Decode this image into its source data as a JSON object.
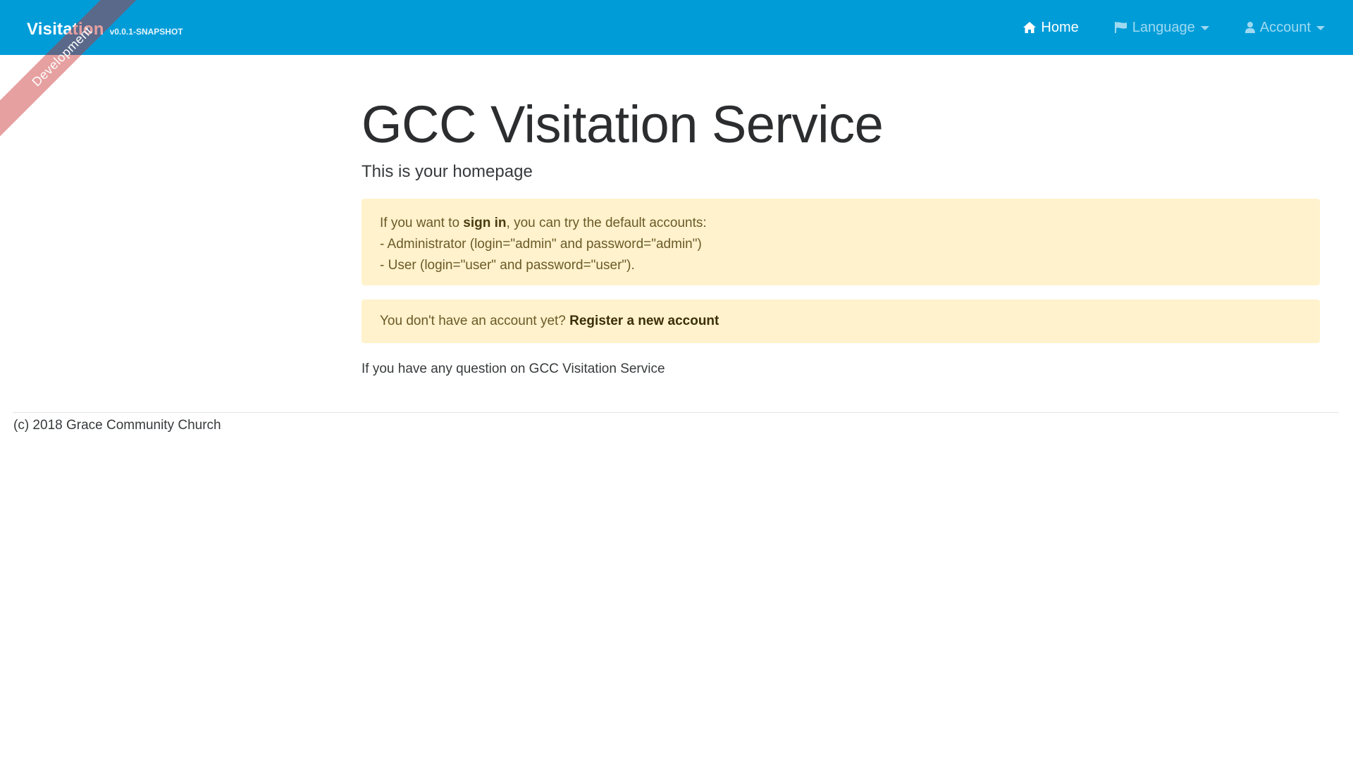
{
  "navbar": {
    "brand_title": "Visitation",
    "brand_version": "v0.0.1-SNAPSHOT",
    "ribbon_label": "Development",
    "items": [
      {
        "label": "Home",
        "icon": "home-icon"
      },
      {
        "label": "Language",
        "icon": "flag-icon"
      },
      {
        "label": "Account",
        "icon": "user-icon"
      }
    ]
  },
  "main": {
    "title": "GCC Visitation Service",
    "lead": "This is your homepage",
    "alert_signin": {
      "prefix": "If you want to ",
      "link": "sign in",
      "suffix": ", you can try the default accounts:",
      "line2": "- Administrator (login=\"admin\" and password=\"admin\")",
      "line3": "- User (login=\"user\" and password=\"user\")."
    },
    "alert_register": {
      "prefix": "You don't have an account yet? ",
      "link": "Register a new account"
    },
    "question": "If you have any question on GCC Visitation Service"
  },
  "footer": {
    "copyright": "(c) 2018 Grace Community Church"
  },
  "colors": {
    "navbar": "#009cd8",
    "alert_bg": "#fff2cc",
    "ribbon": "#c82d2d"
  }
}
